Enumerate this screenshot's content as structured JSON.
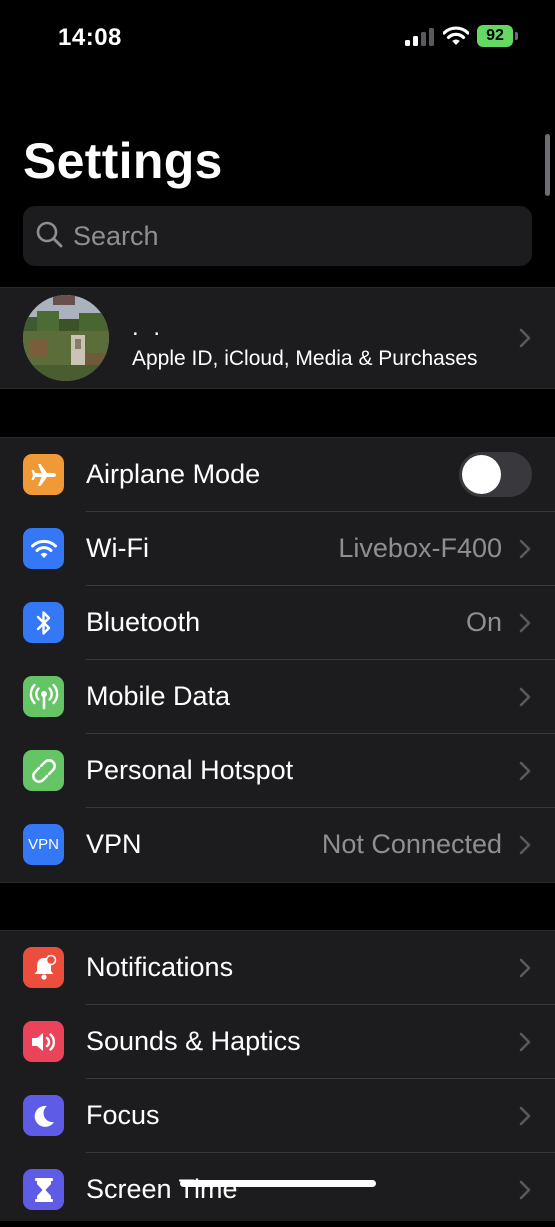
{
  "status_bar": {
    "time": "14:08",
    "battery": "92"
  },
  "header": {
    "title": "Settings"
  },
  "search": {
    "placeholder": "Search"
  },
  "profile": {
    "name": ". .",
    "subtitle": "Apple ID, iCloud, Media & Purchases"
  },
  "groups": {
    "connectivity": [
      {
        "label": "Airplane Mode",
        "icon": "airplane-icon",
        "color": "#f09a37",
        "toggle": false
      },
      {
        "label": "Wi-Fi",
        "value": "Livebox-F400",
        "icon": "wifi-icon",
        "color": "#3478f6"
      },
      {
        "label": "Bluetooth",
        "value": "On",
        "icon": "bluetooth-icon",
        "color": "#3478f6"
      },
      {
        "label": "Mobile Data",
        "icon": "antenna-icon",
        "color": "#65c466"
      },
      {
        "label": "Personal Hotspot",
        "icon": "hotspot-icon",
        "color": "#65c466"
      },
      {
        "label": "VPN",
        "value": "Not Connected",
        "icon": "vpn-icon",
        "icon_text": "VPN",
        "color": "#3478f6"
      }
    ],
    "system": [
      {
        "label": "Notifications",
        "icon": "bell-icon",
        "color": "#eb4e3d"
      },
      {
        "label": "Sounds & Haptics",
        "icon": "speaker-icon",
        "color": "#eb445a"
      },
      {
        "label": "Focus",
        "icon": "moon-icon",
        "color": "#5e5ce6"
      },
      {
        "label": "Screen Time",
        "icon": "hourglass-icon",
        "color": "#5e5ce6"
      }
    ]
  }
}
